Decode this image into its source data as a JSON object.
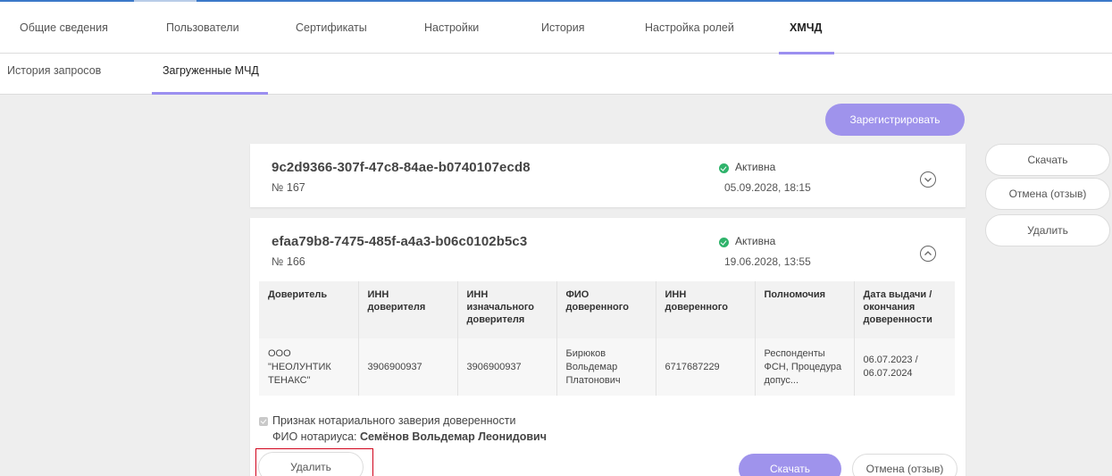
{
  "tabs": [
    {
      "label": "Общие сведения"
    },
    {
      "label": "Пользователи"
    },
    {
      "label": "Сертификаты"
    },
    {
      "label": "Настройки"
    },
    {
      "label": "История"
    },
    {
      "label": "Настройка ролей"
    },
    {
      "label": "ХМЧД",
      "active": true
    }
  ],
  "subtabs": [
    {
      "label": "История запросов"
    },
    {
      "label": "Загруженные МЧД",
      "active": true
    }
  ],
  "register_button": "Зарегистрировать",
  "side_actions": {
    "download": "Скачать",
    "cancel": "Отмена (отзыв)",
    "delete": "Удалить"
  },
  "cards": [
    {
      "id": "9c2d9366-307f-47c8-84ae-b0740107ecd8",
      "number": "№ 167",
      "status": "Активна",
      "date": "05.09.2028, 18:15",
      "expanded": false
    },
    {
      "id": "efaa79b8-7475-485f-a4a3-b06c0102b5c3",
      "number": "№ 166",
      "status": "Активна",
      "date": "19.06.2028, 13:55",
      "expanded": true,
      "table": {
        "headers": [
          "Доверитель",
          "ИНН доверителя",
          "ИНН изначального доверителя",
          "ФИО доверенного",
          "ИНН доверенного",
          "Полномочия",
          "Дата выдачи / окончания доверенности"
        ],
        "row": [
          "ООО \"НЕОЛУНТИК ТЕНАКС\"",
          "3906900937",
          "3906900937",
          "Бирюков Вольдемар Платонович",
          "6717687229",
          "Респонденты ФСН, Процедура допус...",
          "06.07.2023 / 06.07.2024"
        ]
      },
      "notary_flag": "Признак нотариального заверия доверенности",
      "notary_label": "ФИО нотариуса:",
      "notary_name": "Семёнов Вольдемар Леонидович",
      "buttons": {
        "delete": "Удалить",
        "download": "Скачать",
        "cancel": "Отмена (отзыв)"
      }
    }
  ],
  "colors": {
    "accent": "#9f93ec",
    "status_active": "#2fb36b",
    "highlight": "#d0021b",
    "top_bar": "#3b79c9"
  }
}
